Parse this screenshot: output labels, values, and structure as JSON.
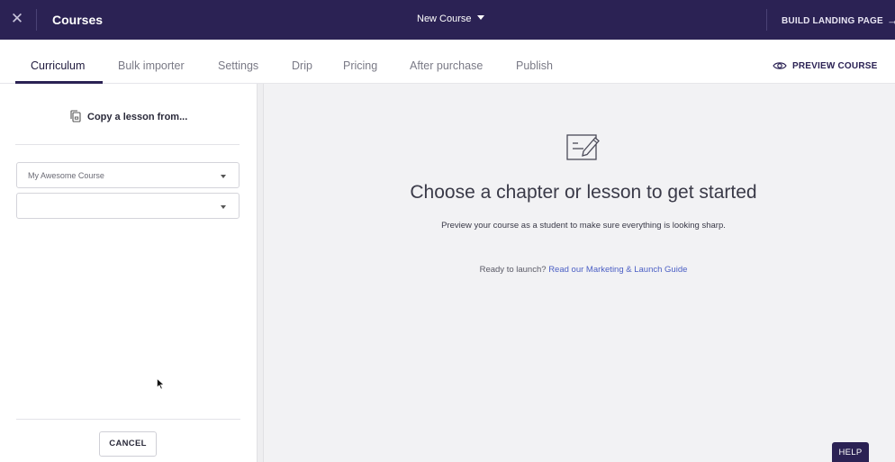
{
  "topbar": {
    "close_icon": "close-icon",
    "title": "Courses",
    "course_select": "New Course",
    "build_landing_page": "BUILD LANDING PAGE",
    "arrow": "→"
  },
  "tabs": [
    {
      "label": "Curriculum",
      "active": true
    },
    {
      "label": "Bulk importer"
    },
    {
      "label": "Settings"
    },
    {
      "label": "Drip"
    },
    {
      "label": "Pricing"
    },
    {
      "label": "After purchase"
    },
    {
      "label": "Publish"
    }
  ],
  "preview_course": "PREVIEW COURSE",
  "left_panel": {
    "copy_label": "Copy a lesson from...",
    "course_select_value": "My Awesome Course",
    "lesson_select_value": "",
    "cancel_label": "CANCEL"
  },
  "main": {
    "headline": "Choose a chapter or lesson to get started",
    "subtext": "Preview your course as a student to make sure everything is looking sharp.",
    "launch_prefix": "Ready to launch?",
    "launch_link": "Read our Marketing & Launch Guide"
  },
  "help_label": "HELP",
  "colors": {
    "topbar_bg": "#2b2254",
    "main_bg": "#f2f2f4",
    "link": "#4b5fc4"
  }
}
